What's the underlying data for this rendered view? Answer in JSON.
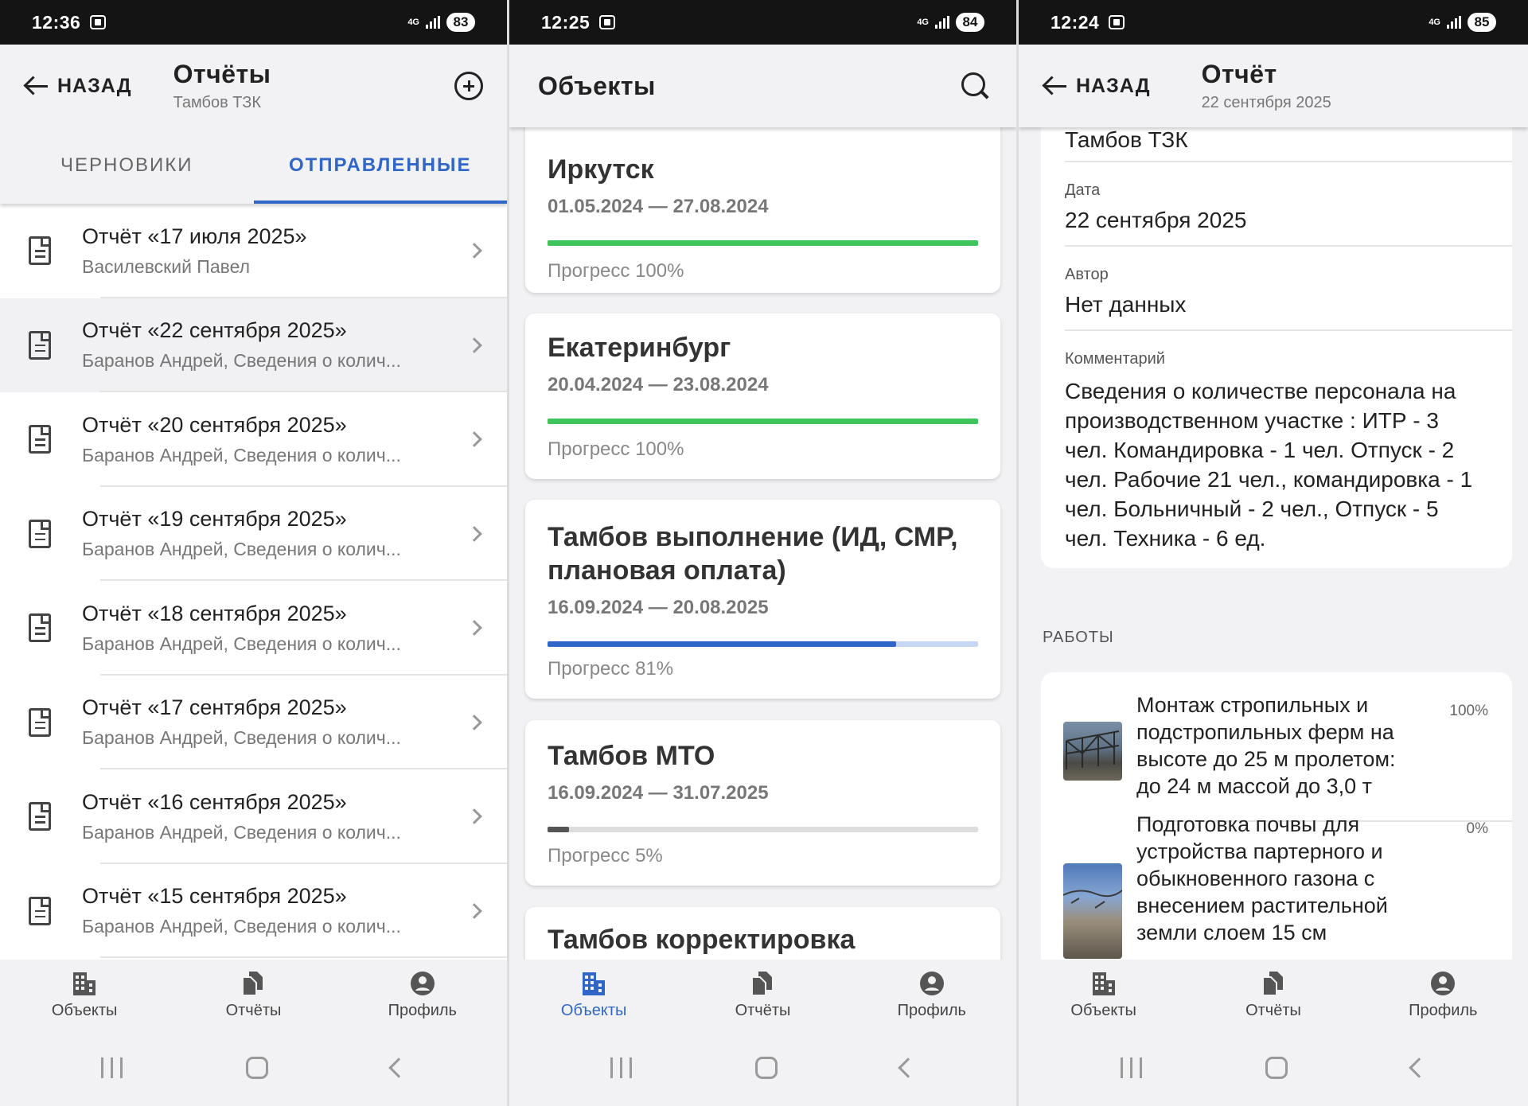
{
  "screens": [
    {
      "status": {
        "time": "12:36",
        "network": "4G",
        "battery": "83"
      },
      "header": {
        "back_label": "НАЗАД",
        "title": "Отчёты",
        "subtitle": "Тамбов ТЗК"
      },
      "tabs": [
        {
          "label": "ЧЕРНОВИКИ",
          "active": false
        },
        {
          "label": "ОТПРАВЛЕННЫЕ",
          "active": true
        }
      ],
      "reports": [
        {
          "title": "Отчёт «17 июля 2025»",
          "subtitle": "Василевский Павел"
        },
        {
          "title": "Отчёт «22 сентября 2025»",
          "subtitle": "Баранов Андрей, Сведения о колич..."
        },
        {
          "title": "Отчёт «20 сентября 2025»",
          "subtitle": "Баранов Андрей, Сведения о колич..."
        },
        {
          "title": "Отчёт «19 сентября 2025»",
          "subtitle": "Баранов Андрей, Сведения о колич..."
        },
        {
          "title": "Отчёт «18 сентября 2025»",
          "subtitle": "Баранов Андрей, Сведения о колич..."
        },
        {
          "title": "Отчёт «17 сентября 2025»",
          "subtitle": "Баранов Андрей, Сведения о колич..."
        },
        {
          "title": "Отчёт «16 сентября 2025»",
          "subtitle": "Баранов Андрей, Сведения о колич..."
        },
        {
          "title": "Отчёт «15 сентября 2025»",
          "subtitle": "Баранов Андрей, Сведения о колич..."
        }
      ],
      "nav_active": "objects_none"
    },
    {
      "status": {
        "time": "12:25",
        "network": "4G",
        "battery": "84"
      },
      "header": {
        "title": "Объекты"
      },
      "objects": [
        {
          "name": "Иркутск",
          "dates": "01.05.2024 — 27.08.2024",
          "progress": 100,
          "progress_label": "Прогресс 100%",
          "color": "#3ec45a"
        },
        {
          "name": "Екатеринбург",
          "dates": "20.04.2024 — 23.08.2024",
          "progress": 100,
          "progress_label": "Прогресс 100%",
          "color": "#3ec45a"
        },
        {
          "name": "Тамбов выполнение (ИД, СМР, плановая оплата)",
          "dates": "16.09.2024 — 20.08.2025",
          "progress": 81,
          "progress_label": "Прогресс 81%",
          "color": "#2f66c7",
          "track": "#c8d7f1"
        },
        {
          "name": "Тамбов МТО",
          "dates": "16.09.2024 — 31.07.2025",
          "progress": 5,
          "progress_label": "Прогресс 5%",
          "color": "#555555",
          "track": "#dddddd"
        },
        {
          "name": "Тамбов корректировка"
        }
      ]
    },
    {
      "status": {
        "time": "12:24",
        "network": "4G",
        "battery": "85"
      },
      "header": {
        "back_label": "НАЗАД",
        "title": "Отчёт",
        "subtitle": "22 сентября 2025"
      },
      "object_value": "Тамбов ТЗК",
      "fields": [
        {
          "label": "Дата",
          "value": "22 сентября 2025"
        },
        {
          "label": "Автор",
          "value": "Нет данных"
        },
        {
          "label": "Комментарий",
          "value": "Сведения о количестве персонала на производственном участке : ИТР - 3 чел. Командировка - 1 чел. Отпуск - 2 чел. Рабочие 21 чел., командировка - 1 чел. Больничный - 2 чел., Отпуск - 5 чел. Техника - 6 ед."
        }
      ],
      "works_header": "РАБОТЫ",
      "works": [
        {
          "text": "Монтаж стропильных и подстропильных ферм на высоте до 25 м пролетом: до 24 м массой до 3,0 т",
          "percent": "100%"
        },
        {
          "text": "Подготовка почвы для устройства партерного и обыкновенного газона с внесением растительной земли слоем 15 см",
          "percent": "0%"
        }
      ]
    }
  ],
  "bottom_nav": [
    {
      "label": "Объекты",
      "icon": "building-icon"
    },
    {
      "label": "Отчёты",
      "icon": "documents-icon"
    },
    {
      "label": "Профиль",
      "icon": "profile-icon"
    }
  ],
  "colors": {
    "accent": "#2f66c7",
    "success": "#3ec45a"
  }
}
